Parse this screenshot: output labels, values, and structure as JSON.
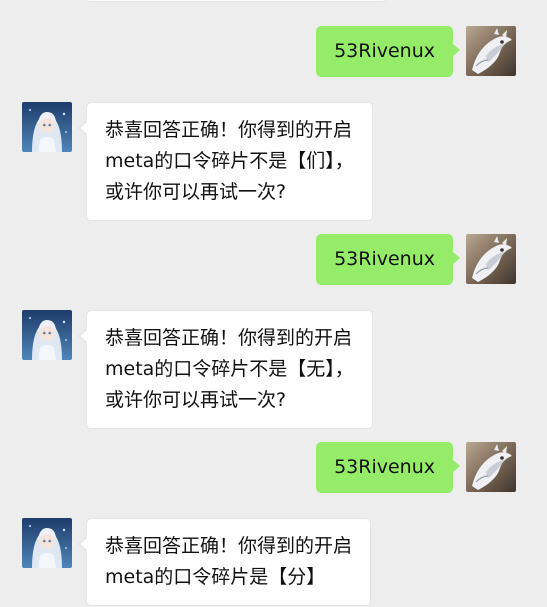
{
  "chat": {
    "messages": [
      {
        "sender": "me",
        "text": "53Rivenux"
      },
      {
        "sender": "bot",
        "lines": [
          "恭喜回答正确！你得到的开启",
          "meta的口令碎片不是【们】，",
          "或许你可以再试一次?"
        ]
      },
      {
        "sender": "me",
        "text": "53Rivenux"
      },
      {
        "sender": "bot",
        "lines": [
          "恭喜回答正确！你得到的开启",
          "meta的口令碎片不是【无】，",
          "或许你可以再试一次?"
        ]
      },
      {
        "sender": "me",
        "text": "53Rivenux"
      },
      {
        "sender": "bot",
        "lines": [
          "恭喜回答正确！你得到的开启",
          "meta的口令碎片是【分】"
        ]
      }
    ]
  },
  "colors": {
    "background": "#ededed",
    "sent_bubble": "#95ec69",
    "received_bubble": "#ffffff",
    "text": "#111111"
  },
  "icons": {
    "bot_avatar": "anime-girl-avatar-icon",
    "user_avatar": "white-dragon-avatar-icon"
  }
}
